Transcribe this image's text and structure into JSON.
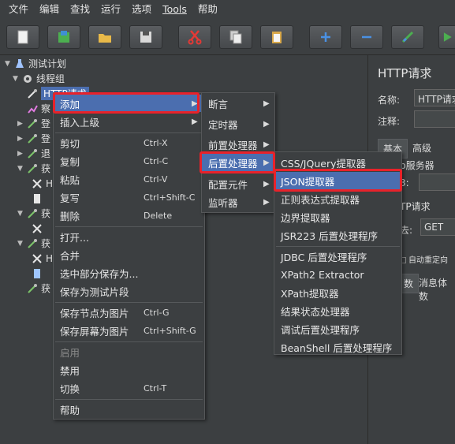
{
  "menubar": [
    "文件",
    "编辑",
    "查找",
    "运行",
    "选项",
    "Tools",
    "帮助"
  ],
  "toolbar": {
    "icons": [
      "new-icon",
      "templates-icon",
      "open-icon",
      "save-icon",
      "cut-icon",
      "copy-icon",
      "paste-icon",
      "expand-icon",
      "collapse-icon",
      "toggle-icon",
      "run-icon"
    ]
  },
  "tree": {
    "root": "测试计划",
    "thread_group": "线程组",
    "selected": "HTTP请求",
    "partial": [
      "察",
      "登",
      "登",
      "退",
      "获",
      "H",
      "获",
      "获",
      "H",
      "获"
    ]
  },
  "context_menu": {
    "items": [
      {
        "label": "添加",
        "arrow": "▶"
      },
      {
        "label": "插入上级",
        "arrow": "▶"
      },
      {
        "label": "剪切",
        "shortcut": "Ctrl-X"
      },
      {
        "label": "复制",
        "shortcut": "Ctrl-C"
      },
      {
        "label": "粘贴",
        "shortcut": "Ctrl-V"
      },
      {
        "label": "复写",
        "shortcut": "Ctrl+Shift-C"
      },
      {
        "label": "删除",
        "shortcut": "Delete"
      },
      {
        "label": "打开..."
      },
      {
        "label": "合并"
      },
      {
        "label": "选中部分保存为..."
      },
      {
        "label": "保存为测试片段"
      },
      {
        "label": "保存节点为图片",
        "shortcut": "Ctrl-G"
      },
      {
        "label": "保存屏幕为图片",
        "shortcut": "Ctrl+Shift-G"
      },
      {
        "label": "启用"
      },
      {
        "label": "禁用"
      },
      {
        "label": "切换",
        "shortcut": "Ctrl-T"
      },
      {
        "label": "帮助"
      }
    ]
  },
  "submenu_add": {
    "items": [
      {
        "label": "断言",
        "arrow": "▶"
      },
      {
        "label": "定时器",
        "arrow": "▶"
      },
      {
        "label": "前置处理器",
        "arrow": "▶"
      },
      {
        "label": "后置处理器",
        "arrow": "▶"
      },
      {
        "label": "配置元件",
        "arrow": "▶"
      },
      {
        "label": "监听器",
        "arrow": "▶"
      }
    ]
  },
  "submenu_post": {
    "items": [
      {
        "label": "CSS/JQuery提取器"
      },
      {
        "label": "JSON提取器"
      },
      {
        "label": "正则表达式提取器"
      },
      {
        "label": "边界提取器"
      },
      {
        "label": "JSR223 后置处理程序"
      },
      {
        "label": "JDBC 后置处理程序"
      },
      {
        "label": "XPath2 Extractor"
      },
      {
        "label": "XPath提取器"
      },
      {
        "label": "结果状态处理器"
      },
      {
        "label": "调试后置处理程序"
      },
      {
        "label": "BeanShell 后置处理程序"
      }
    ]
  },
  "right_panel": {
    "title": "HTTP请求",
    "name_label": "名称:",
    "name_value": "HTTP请求",
    "comment_label": "注释:",
    "tab_basic": "基本",
    "tab_advanced": "高级",
    "web_server": "b服务器",
    "protocol_short": "3:",
    "http_request": "TP请求",
    "method_label": "去:",
    "method_value": "GET",
    "auto_redirect": "自动重定向",
    "params_tab": "数",
    "body_tab": "消息体数"
  },
  "colors": {
    "background": "#3c3f41",
    "highlight": "#4b6eaf",
    "annotation_red": "#e8222a"
  }
}
